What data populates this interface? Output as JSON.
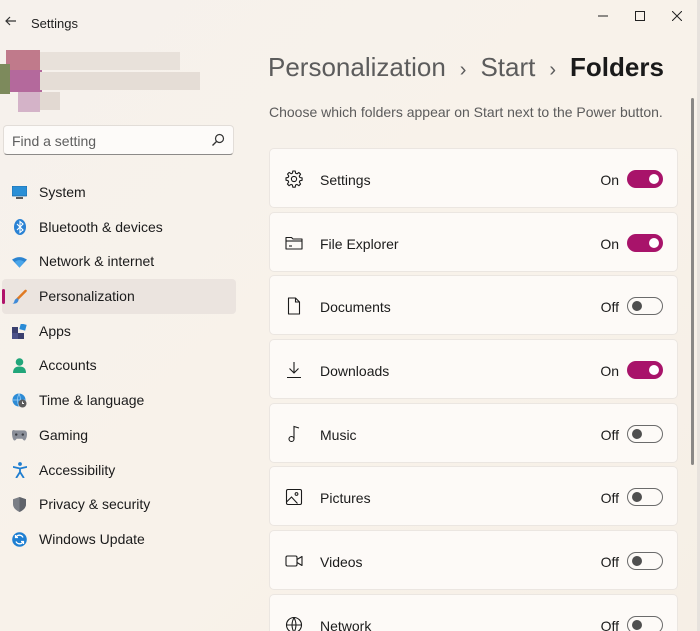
{
  "window": {
    "title": "Settings",
    "back_icon": "back-arrow-icon",
    "controls": {
      "minimize": "—",
      "maximize": "☐",
      "close": "✕"
    }
  },
  "search": {
    "placeholder": "Find a setting",
    "icon": "search-icon"
  },
  "sidebar": {
    "items": [
      {
        "label": "System",
        "icon": "system-icon",
        "active": false
      },
      {
        "label": "Bluetooth & devices",
        "icon": "bluetooth-icon",
        "active": false
      },
      {
        "label": "Network & internet",
        "icon": "wifi-icon",
        "active": false
      },
      {
        "label": "Personalization",
        "icon": "brush-icon",
        "active": true
      },
      {
        "label": "Apps",
        "icon": "apps-icon",
        "active": false
      },
      {
        "label": "Accounts",
        "icon": "person-icon",
        "active": false
      },
      {
        "label": "Time & language",
        "icon": "globe-clock-icon",
        "active": false
      },
      {
        "label": "Gaming",
        "icon": "gamepad-icon",
        "active": false
      },
      {
        "label": "Accessibility",
        "icon": "accessibility-icon",
        "active": false
      },
      {
        "label": "Privacy & security",
        "icon": "shield-icon",
        "active": false
      },
      {
        "label": "Windows Update",
        "icon": "update-icon",
        "active": false
      }
    ]
  },
  "main": {
    "breadcrumb": [
      "Personalization",
      "Start",
      "Folders"
    ],
    "description": "Choose which folders appear on Start next to the Power button.",
    "folders": [
      {
        "label": "Settings",
        "icon": "gear-icon",
        "state": "On"
      },
      {
        "label": "File Explorer",
        "icon": "folder-icon",
        "state": "On"
      },
      {
        "label": "Documents",
        "icon": "document-icon",
        "state": "Off"
      },
      {
        "label": "Downloads",
        "icon": "download-icon",
        "state": "On"
      },
      {
        "label": "Music",
        "icon": "music-icon",
        "state": "Off"
      },
      {
        "label": "Pictures",
        "icon": "picture-icon",
        "state": "Off"
      },
      {
        "label": "Videos",
        "icon": "video-icon",
        "state": "Off"
      },
      {
        "label": "Network",
        "icon": "network-globe-icon",
        "state": "Off"
      }
    ]
  },
  "colors": {
    "accent": "#a8136a",
    "background": "#f6f1ec",
    "card": "#fdfaf7"
  }
}
